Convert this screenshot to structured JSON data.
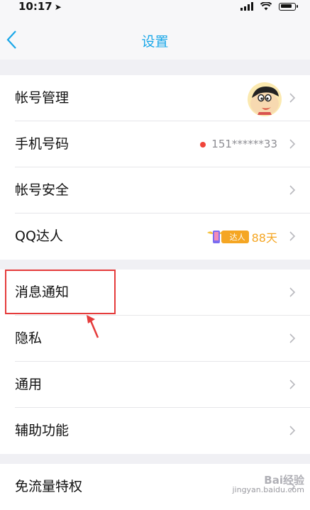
{
  "status_bar": {
    "time": "10:17",
    "location_glyph": "➤"
  },
  "nav": {
    "title": "设置",
    "back_icon": "chevron-left-icon"
  },
  "groups": [
    {
      "rows": [
        {
          "label": "帐号管理",
          "type": "avatar"
        },
        {
          "label": "手机号码",
          "value": "151******33",
          "type": "phone"
        },
        {
          "label": "帐号安全",
          "type": "plain"
        },
        {
          "label": "QQ达人",
          "badge": "达人",
          "days": "88天",
          "type": "daren"
        }
      ]
    },
    {
      "rows": [
        {
          "label": "消息通知"
        },
        {
          "label": "隐私"
        },
        {
          "label": "通用"
        },
        {
          "label": "辅助功能"
        }
      ]
    },
    {
      "rows": [
        {
          "label": "免流量特权"
        }
      ]
    }
  ],
  "colors": {
    "accent": "#1aa7e8",
    "highlight": "#e53b3b",
    "daren": "#f5a623"
  },
  "watermark": {
    "logo": "Bai经验",
    "url": "jingyan.baidu.com"
  }
}
